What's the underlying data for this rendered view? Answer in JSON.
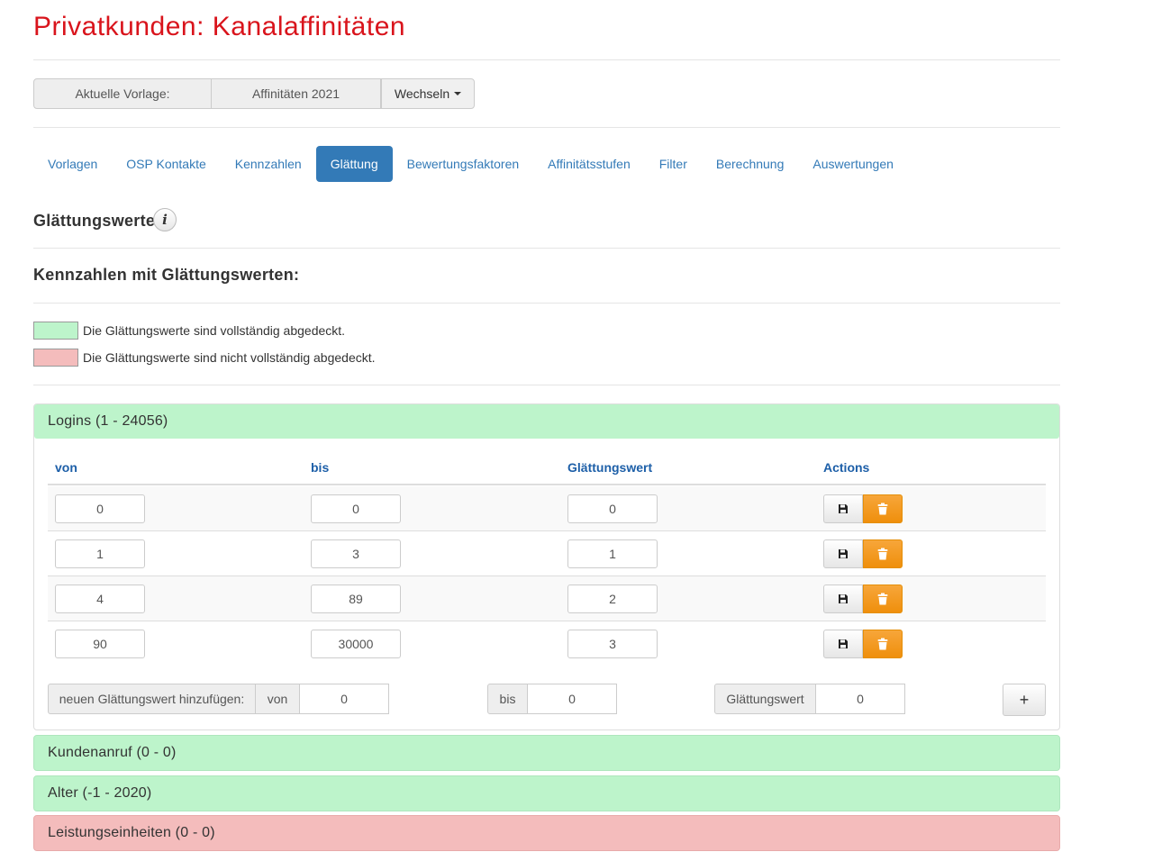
{
  "page": {
    "title": "Privatkunden: Kanalaffinitäten"
  },
  "vorlage": {
    "label": "Aktuelle Vorlage:",
    "value": "Affinitäten 2021",
    "switch_label": "Wechseln"
  },
  "tabs": [
    {
      "label": "Vorlagen",
      "active": false
    },
    {
      "label": "OSP Kontakte",
      "active": false
    },
    {
      "label": "Kennzahlen",
      "active": false
    },
    {
      "label": "Glättung",
      "active": true
    },
    {
      "label": "Bewertungsfaktoren",
      "active": false
    },
    {
      "label": "Affinitätsstufen",
      "active": false
    },
    {
      "label": "Filter",
      "active": false
    },
    {
      "label": "Berechnung",
      "active": false
    },
    {
      "label": "Auswertungen",
      "active": false
    }
  ],
  "section": {
    "title": "Glättungswerte",
    "subtitle": "Kennzahlen mit Glättungswerten:"
  },
  "legend": {
    "complete": {
      "text": "Die Glättungswerte sind vollständig abgedeckt.",
      "color": "#bdf4cb"
    },
    "incomplete": {
      "text": "Die Glättungswerte sind nicht vollständig abgedeckt.",
      "color": "#f4bcbc"
    }
  },
  "panels": [
    {
      "title": "Logins (1 - 24056)",
      "status": "complete",
      "expanded": true,
      "columns": {
        "von": "von",
        "bis": "bis",
        "wert": "Glättungswert",
        "actions": "Actions"
      },
      "rows": [
        {
          "von": "0",
          "bis": "0",
          "wert": "0"
        },
        {
          "von": "1",
          "bis": "3",
          "wert": "1"
        },
        {
          "von": "4",
          "bis": "89",
          "wert": "2"
        },
        {
          "von": "90",
          "bis": "30000",
          "wert": "3"
        }
      ],
      "add": {
        "label": "neuen Glättungswert hinzufügen:",
        "von_label": "von",
        "von_value": "0",
        "bis_label": "bis",
        "bis_value": "0",
        "wert_label": "Glättungswert",
        "wert_value": "0",
        "button": "+"
      }
    },
    {
      "title": "Kundenanruf (0 - 0)",
      "status": "complete",
      "expanded": false
    },
    {
      "title": "Alter (-1 - 2020)",
      "status": "complete",
      "expanded": false
    },
    {
      "title": "Leistungseinheiten (0 - 0)",
      "status": "incomplete",
      "expanded": false
    }
  ],
  "icons": {
    "info": "info-icon",
    "save": "floppy-disk-icon",
    "delete": "trash-icon"
  }
}
